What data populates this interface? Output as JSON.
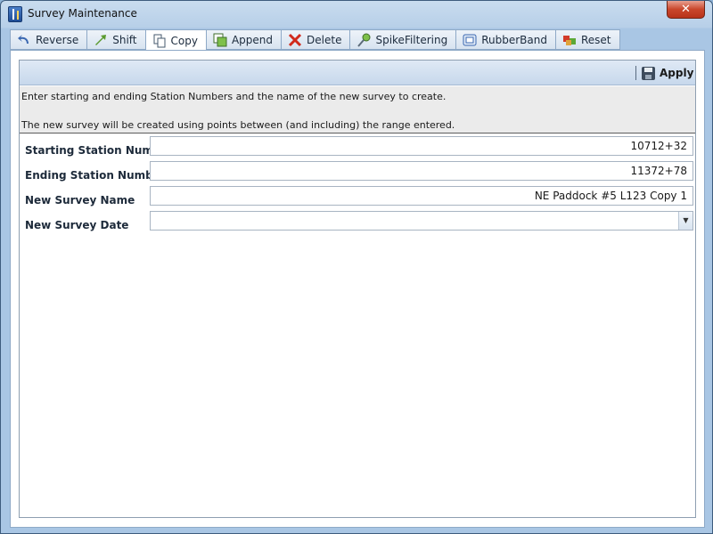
{
  "window": {
    "title": "Survey Maintenance",
    "close_glyph": "✕"
  },
  "tabs": [
    {
      "label": "Reverse",
      "icon": "reverse-arrow-icon"
    },
    {
      "label": "Shift",
      "icon": "shift-arrow-icon"
    },
    {
      "label": "Copy",
      "icon": "copy-icon",
      "active": true
    },
    {
      "label": "Append",
      "icon": "append-icon"
    },
    {
      "label": "Delete",
      "icon": "delete-x-icon"
    },
    {
      "label": "SpikeFiltering",
      "icon": "spike-filter-icon"
    },
    {
      "label": "RubberBand",
      "icon": "rubberband-icon"
    },
    {
      "label": "Reset",
      "icon": "reset-icon"
    }
  ],
  "toolbar": {
    "apply_label": "Apply",
    "apply_icon": "save-disk-icon"
  },
  "info": {
    "line1": "Enter starting and ending Station Numbers and the name of the new survey to create.",
    "line2": "The new survey will be created using points between (and including) the range entered."
  },
  "form": {
    "start_label": "Starting Station Number",
    "start_value": "10712+32",
    "end_label": "Ending Station Number",
    "end_value": "11372+78",
    "name_label": "New Survey Name",
    "name_value": "NE Paddock #5 L123 Copy 1",
    "date_label": "New Survey Date",
    "date_value": ""
  },
  "colors": {
    "accent": "#b7cfe8",
    "close": "#c9462b",
    "info_bg": "#ebebeb"
  }
}
